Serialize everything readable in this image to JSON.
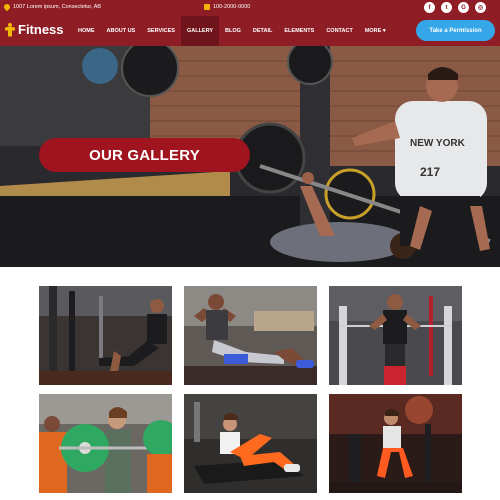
{
  "topbar": {
    "address": "1007 Lorem ipsum, Consectetur, AB",
    "phone": "100-2000-0000",
    "social": [
      {
        "icon": "facebook-icon",
        "glyph": "f"
      },
      {
        "icon": "twitter-icon",
        "glyph": "t"
      },
      {
        "icon": "google-plus-icon",
        "glyph": "G"
      },
      {
        "icon": "instagram-icon",
        "glyph": "◎"
      }
    ]
  },
  "brand": {
    "name": "Fitness",
    "accent": "#f2b705",
    "primary": "#8f1d26"
  },
  "nav": {
    "items": [
      "HOME",
      "ABOUT US",
      "SERVICES",
      "GALLERY",
      "BLOG",
      "DETAIL",
      "ELEMENTS",
      "CONTACT",
      "MORE ▾"
    ],
    "active": "GALLERY",
    "cta": "Take a Permission"
  },
  "hero": {
    "title": "OUR GALLERY",
    "photo": "man bench pressing barbell with spotter in gym"
  },
  "gallery": [
    "man doing cable exercise with weights",
    "man doing sit-ups on gym floor",
    "man using cable machine",
    "woman holding green weight plate",
    "woman in orange leggings stretching on mat",
    "woman in gym with dumbbells"
  ]
}
